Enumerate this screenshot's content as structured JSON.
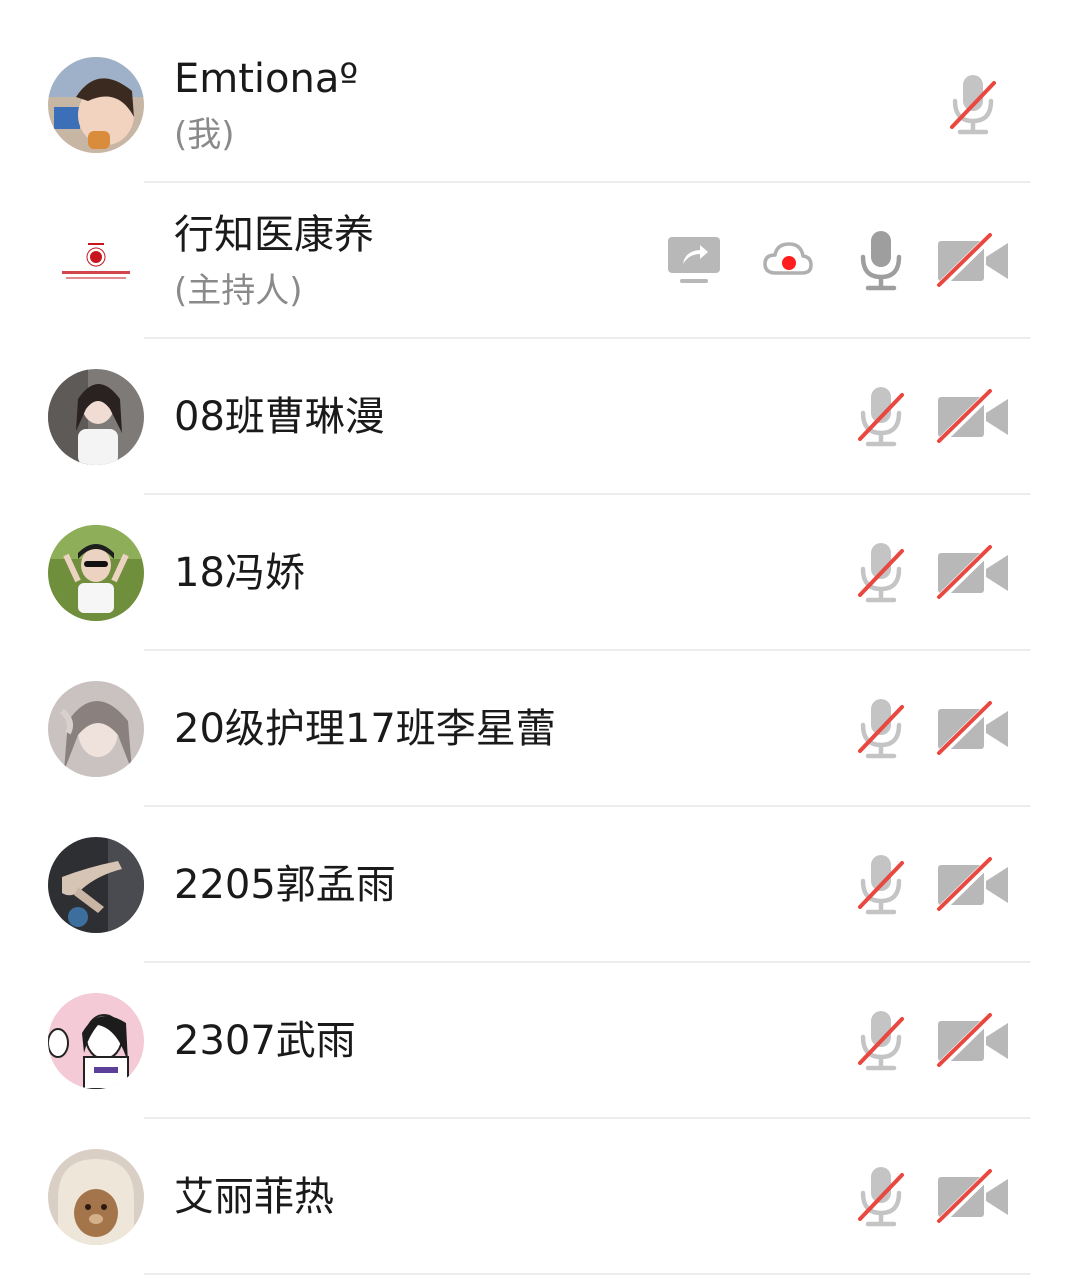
{
  "participants": [
    {
      "name": "Emtionaº",
      "role": "(我)",
      "mic": "muted",
      "camera": null,
      "sharing": false,
      "recording": false
    },
    {
      "name": "行知医康养",
      "role": "(主持人)",
      "mic": "on",
      "camera": "off",
      "sharing": true,
      "recording": true
    },
    {
      "name": "08班曹琳漫",
      "role": "",
      "mic": "muted",
      "camera": "off",
      "sharing": false,
      "recording": false
    },
    {
      "name": "18冯娇",
      "role": "",
      "mic": "muted",
      "camera": "off",
      "sharing": false,
      "recording": false
    },
    {
      "name": "20级护理17班李星蕾",
      "role": "",
      "mic": "muted",
      "camera": "off",
      "sharing": false,
      "recording": false
    },
    {
      "name": "2205郭孟雨",
      "role": "",
      "mic": "muted",
      "camera": "off",
      "sharing": false,
      "recording": false
    },
    {
      "name": "2307武雨",
      "role": "",
      "mic": "muted",
      "camera": "off",
      "sharing": false,
      "recording": false
    },
    {
      "name": "艾丽菲热",
      "role": "",
      "mic": "muted",
      "camera": "off",
      "sharing": false,
      "recording": false
    }
  ],
  "colors": {
    "icon_gray": "#c4c4c4",
    "mic_on_gray": "#9e9e9e",
    "mute_slash_red": "#e8483f",
    "record_red": "#ff1d1d",
    "divider": "#ececec",
    "name_text": "#1a1a1a",
    "role_text": "#8a8a8a"
  },
  "icons": {
    "screen_share": "screen-share-icon",
    "cloud_record": "cloud-record-icon",
    "mic": "microphone-icon",
    "mic_muted": "microphone-muted-icon",
    "camera_off": "camera-off-icon"
  }
}
